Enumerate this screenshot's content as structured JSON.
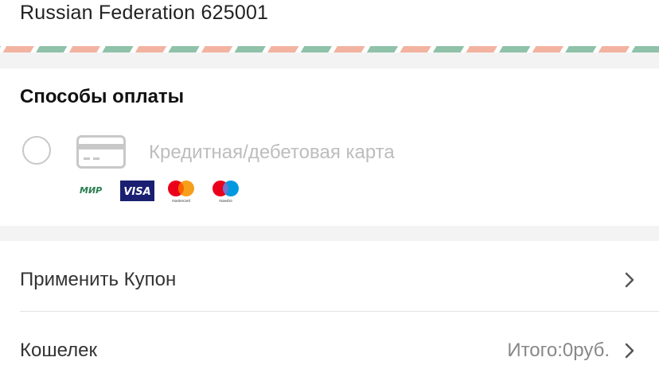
{
  "address": {
    "line": "Russian Federation 625001"
  },
  "payment": {
    "title": "Способы оплаты",
    "methods": [
      {
        "label": "Кредитная/дебетовая карта",
        "selected": false,
        "icon": "credit-card-icon",
        "brands": [
          {
            "name": "МИР",
            "icon": "mir-logo"
          },
          {
            "name": "VISA",
            "icon": "visa-logo"
          },
          {
            "name": "mastercard",
            "icon": "mastercard-logo"
          },
          {
            "name": "maestro",
            "icon": "maestro-logo"
          }
        ]
      }
    ]
  },
  "rows": {
    "coupon": {
      "label": "Применить Купон",
      "icon": "chevron-right-icon"
    },
    "wallet": {
      "label": "Кошелек",
      "value": "Итого:0руб.",
      "icon": "chevron-right-icon"
    }
  },
  "colors": {
    "border_green": "#8fc2a8",
    "border_pink": "#f2b3a0",
    "section_gap": "#f3f3f3",
    "muted_text": "#bdbdbd",
    "visa_blue": "#1a1f71",
    "mir_green": "#2a7d4f",
    "mc_red": "#eb001b",
    "mc_orange": "#f79e1b",
    "maestro_blue": "#0099df"
  }
}
